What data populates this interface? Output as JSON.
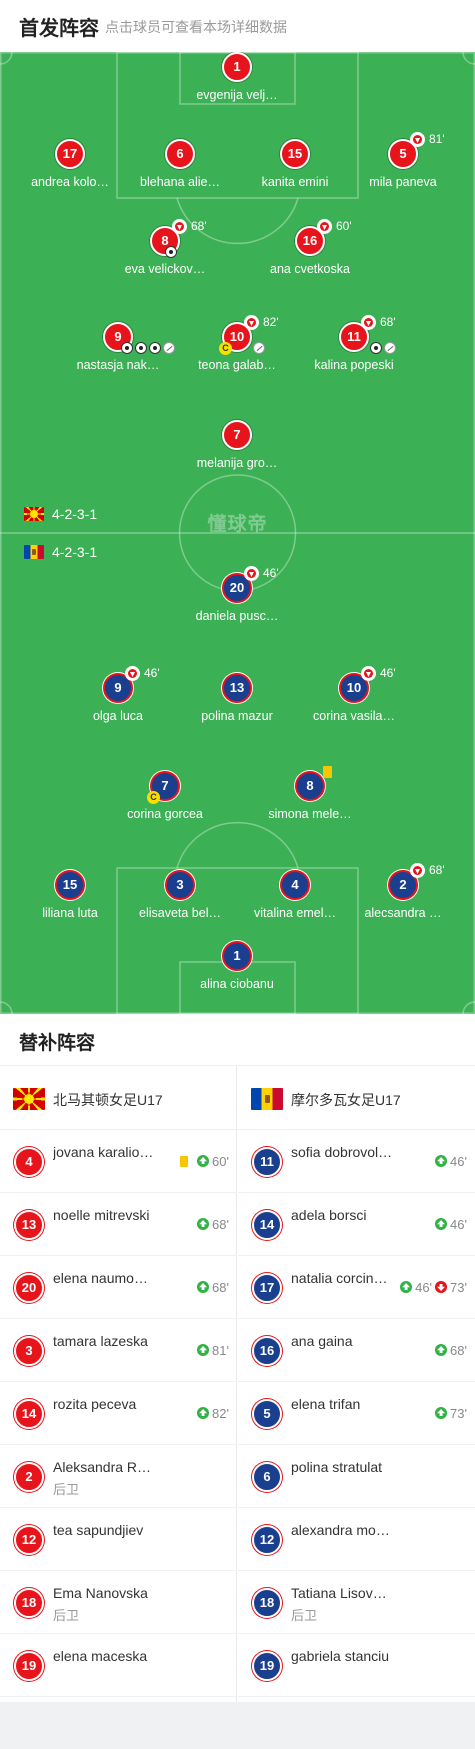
{
  "header": {
    "title": "首发阵容",
    "subtitle": "点击球员可查看本场详细数据"
  },
  "colors": {
    "pitch": "#3cb054",
    "home": "#e8141b",
    "away": "#1a3f8f",
    "sub_in": "#2fb344"
  },
  "watermark": "懂球帝",
  "formations": {
    "home": "4-2-3-1",
    "away": "4-2-3-1"
  },
  "home_lineup": [
    {
      "number": "1",
      "name": "evgenija velj…"
    },
    {
      "number": "17",
      "name": "andrea kolo…"
    },
    {
      "number": "6",
      "name": "blehana alie…"
    },
    {
      "number": "15",
      "name": "kanita emini"
    },
    {
      "number": "5",
      "name": "mila paneva",
      "sub_minute": "81'"
    },
    {
      "number": "8",
      "name": "eva velickov…",
      "sub_minute": "68'",
      "goals": 1
    },
    {
      "number": "16",
      "name": "ana cvetkoska",
      "sub_minute": "60'"
    },
    {
      "number": "9",
      "name": "nastasja nak…",
      "goals": 3,
      "assists": 1
    },
    {
      "number": "10",
      "name": "teona galab…",
      "sub_minute": "82'",
      "captain": "C",
      "assists": 1
    },
    {
      "number": "11",
      "name": "kalina popeski",
      "sub_minute": "68'",
      "goals": 1,
      "assists": 1
    },
    {
      "number": "7",
      "name": "melanija gro…"
    }
  ],
  "away_lineup": [
    {
      "number": "20",
      "name": "daniela pusc…",
      "sub_minute": "46'"
    },
    {
      "number": "9",
      "name": "olga luca",
      "sub_minute": "46'"
    },
    {
      "number": "13",
      "name": "polina mazur"
    },
    {
      "number": "10",
      "name": "corina vasila…",
      "sub_minute": "46'"
    },
    {
      "number": "7",
      "name": "corina gorcea",
      "captain": "C"
    },
    {
      "number": "8",
      "name": "simona mele…",
      "yellow_card": true
    },
    {
      "number": "15",
      "name": "liliana luta"
    },
    {
      "number": "3",
      "name": "elisaveta bel…"
    },
    {
      "number": "4",
      "name": "vitalina emel…"
    },
    {
      "number": "2",
      "name": "alecsandra …",
      "sub_minute": "68'"
    },
    {
      "number": "1",
      "name": "alina ciobanu"
    }
  ],
  "subs": {
    "title": "替补阵容",
    "home_team": "北马其顿女足U17",
    "away_team": "摩尔多瓦女足U17",
    "home": [
      {
        "number": "4",
        "name": "jovana karalio…",
        "yellow": true,
        "in": "60'"
      },
      {
        "number": "13",
        "name": "noelle mitrevski",
        "in": "68'"
      },
      {
        "number": "20",
        "name": "elena naumo…",
        "in": "68'"
      },
      {
        "number": "3",
        "name": "tamara lazeska",
        "in": "81'"
      },
      {
        "number": "14",
        "name": "rozita peceva",
        "in": "82'"
      },
      {
        "number": "2",
        "name": "Aleksandra R…",
        "position": "后卫"
      },
      {
        "number": "12",
        "name": "tea sapundjiev"
      },
      {
        "number": "18",
        "name": "Ema Nanovska",
        "position": "后卫"
      },
      {
        "number": "19",
        "name": "elena maceska"
      }
    ],
    "away": [
      {
        "number": "11",
        "name": "sofia dobrovol…",
        "in": "46'"
      },
      {
        "number": "14",
        "name": "adela borsci",
        "in": "46'"
      },
      {
        "number": "17",
        "name": "natalia corcin…",
        "in": "46'",
        "out": "73'"
      },
      {
        "number": "16",
        "name": "ana gaina",
        "in": "68'"
      },
      {
        "number": "5",
        "name": "elena trifan",
        "in": "73'"
      },
      {
        "number": "6",
        "name": "polina stratulat"
      },
      {
        "number": "12",
        "name": "alexandra mo…"
      },
      {
        "number": "18",
        "name": "Tatiana Lisov…",
        "position": "后卫"
      },
      {
        "number": "19",
        "name": "gabriela stanciu"
      }
    ]
  }
}
